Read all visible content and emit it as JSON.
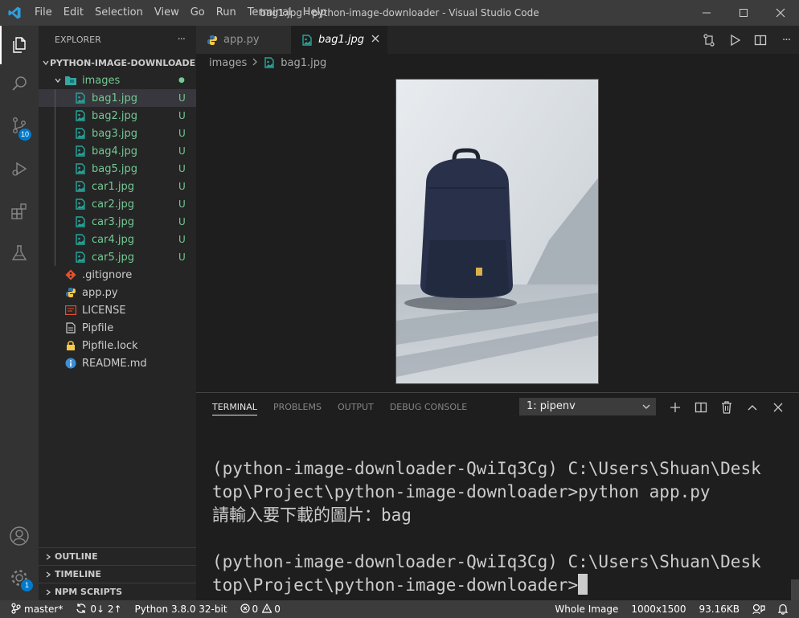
{
  "window": {
    "title": "bag1.jpg - python-image-downloader - Visual Studio Code",
    "menu": [
      "File",
      "Edit",
      "Selection",
      "View",
      "Go",
      "Run",
      "Terminal",
      "Help"
    ]
  },
  "activity_bar": {
    "scm_badge": "10",
    "settings_badge": "1"
  },
  "explorer": {
    "header": "EXPLORER",
    "more": "···",
    "project": "PYTHON-IMAGE-DOWNLOADER",
    "folder": "images",
    "image_files": [
      {
        "name": "bag1.jpg",
        "status": "U"
      },
      {
        "name": "bag2.jpg",
        "status": "U"
      },
      {
        "name": "bag3.jpg",
        "status": "U"
      },
      {
        "name": "bag4.jpg",
        "status": "U"
      },
      {
        "name": "bag5.jpg",
        "status": "U"
      },
      {
        "name": "car1.jpg",
        "status": "U"
      },
      {
        "name": "car2.jpg",
        "status": "U"
      },
      {
        "name": "car3.jpg",
        "status": "U"
      },
      {
        "name": "car4.jpg",
        "status": "U"
      },
      {
        "name": "car5.jpg",
        "status": "U"
      }
    ],
    "root_files": [
      ".gitignore",
      "app.py",
      "LICENSE",
      "Pipfile",
      "Pipfile.lock",
      "README.md"
    ],
    "sections": [
      "OUTLINE",
      "TIMELINE",
      "NPM SCRIPTS"
    ]
  },
  "tabs": [
    {
      "label": "app.py"
    },
    {
      "label": "bag1.jpg"
    }
  ],
  "breadcrumb": {
    "folder": "images",
    "file": "bag1.jpg"
  },
  "panel": {
    "tabs": [
      "TERMINAL",
      "PROBLEMS",
      "OUTPUT",
      "DEBUG CONSOLE"
    ],
    "terminal_select": "1: pipenv"
  },
  "terminal": {
    "lines": [
      "(python-image-downloader-QwiIq3Cg) C:\\Users\\Shuan\\Desk",
      "top\\Project\\python-image-downloader>python app.py",
      "請輸入要下載的圖片：bag",
      "",
      "(python-image-downloader-QwiIq3Cg) C:\\Users\\Shuan\\Desk",
      "top\\Project\\python-image-downloader>"
    ]
  },
  "status_bar": {
    "branch": "master*",
    "sync": "0↓ 2↑",
    "python": "Python 3.8.0 32-bit",
    "errors": "0",
    "warnings": "0",
    "image_mode": "Whole Image",
    "image_size": "1000x1500",
    "file_size": "93.16KB"
  },
  "colors": {
    "accent": "#007acc",
    "untracked": "#73c991",
    "titlebar": "#3c3c3c",
    "activitybar": "#333333",
    "sidebar": "#252526",
    "editor": "#1e1e1e"
  }
}
